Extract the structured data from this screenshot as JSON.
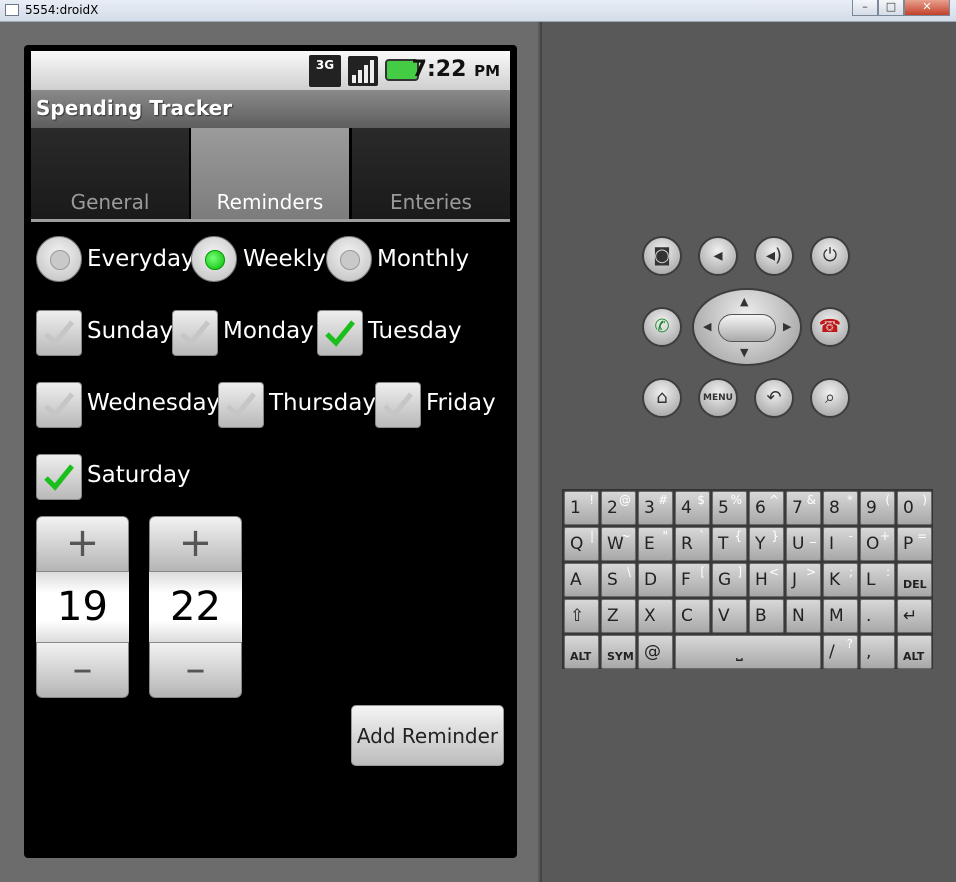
{
  "window": {
    "title": "5554:droidX",
    "min": "–",
    "max": "□",
    "close": "✕"
  },
  "status": {
    "network": "3G",
    "time": "7:22",
    "ampm": "PM"
  },
  "app": {
    "title": "Spending Tracker"
  },
  "tabs": [
    {
      "label": "General"
    },
    {
      "label": "Reminders"
    },
    {
      "label": "Enteries"
    }
  ],
  "frequency": [
    {
      "label": "Everyday",
      "selected": false
    },
    {
      "label": "Weekly",
      "selected": true
    },
    {
      "label": "Monthly",
      "selected": false
    }
  ],
  "days": [
    {
      "label": "Sunday",
      "checked": false
    },
    {
      "label": "Monday",
      "checked": false
    },
    {
      "label": "Tuesday",
      "checked": true
    },
    {
      "label": "Wednesday",
      "checked": false
    },
    {
      "label": "Thursday",
      "checked": false
    },
    {
      "label": "Friday",
      "checked": false
    },
    {
      "label": "Saturday",
      "checked": true
    }
  ],
  "time_picker": {
    "hour": "19",
    "minute": "22",
    "plus": "+",
    "minus": "–"
  },
  "add_button": "Add Reminder",
  "controls": {
    "menu": "MENU"
  },
  "keyboard": {
    "rows": [
      [
        {
          "k": "1",
          "s": "!"
        },
        {
          "k": "2",
          "s": "@"
        },
        {
          "k": "3",
          "s": "#"
        },
        {
          "k": "4",
          "s": "$"
        },
        {
          "k": "5",
          "s": "%"
        },
        {
          "k": "6",
          "s": "^"
        },
        {
          "k": "7",
          "s": "&"
        },
        {
          "k": "8",
          "s": "*"
        },
        {
          "k": "9",
          "s": "("
        },
        {
          "k": "0",
          "s": ")"
        }
      ],
      [
        {
          "k": "Q",
          "s": "|"
        },
        {
          "k": "W",
          "s": "~"
        },
        {
          "k": "E",
          "s": "\""
        },
        {
          "k": "R",
          "s": "`"
        },
        {
          "k": "T",
          "s": "{"
        },
        {
          "k": "Y",
          "s": "}"
        },
        {
          "k": "U",
          "s": "_"
        },
        {
          "k": "I",
          "s": "-"
        },
        {
          "k": "O",
          "s": "+"
        },
        {
          "k": "P",
          "s": "="
        }
      ],
      [
        {
          "k": "A",
          "s": ""
        },
        {
          "k": "S",
          "s": "\\"
        },
        {
          "k": "D",
          "s": ""
        },
        {
          "k": "F",
          "s": "["
        },
        {
          "k": "G",
          "s": "]"
        },
        {
          "k": "H",
          "s": "<"
        },
        {
          "k": "J",
          "s": ">"
        },
        {
          "k": "K",
          "s": ";"
        },
        {
          "k": "L",
          "s": ":"
        },
        {
          "k": "DEL",
          "s": ""
        }
      ],
      [
        {
          "k": "⇧",
          "s": ""
        },
        {
          "k": "Z",
          "s": ""
        },
        {
          "k": "X",
          "s": ""
        },
        {
          "k": "C",
          "s": ""
        },
        {
          "k": "V",
          "s": ""
        },
        {
          "k": "B",
          "s": ""
        },
        {
          "k": "N",
          "s": ""
        },
        {
          "k": "M",
          "s": ""
        },
        {
          "k": ".",
          "s": ""
        },
        {
          "k": "↵",
          "s": ""
        }
      ],
      [
        {
          "k": "ALT",
          "s": ""
        },
        {
          "k": "SYM",
          "s": ""
        },
        {
          "k": "@",
          "s": ""
        },
        {
          "k": "⎵",
          "s": ""
        },
        {
          "k": "/",
          "s": "?"
        },
        {
          "k": ",",
          "s": ""
        },
        {
          "k": "ALT",
          "s": ""
        }
      ]
    ]
  }
}
